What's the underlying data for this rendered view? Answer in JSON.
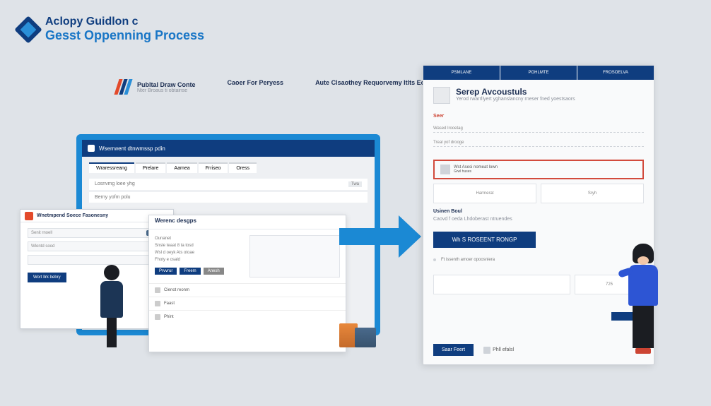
{
  "header": {
    "title1": "Aclopy Guidlon c",
    "title2": "Gesst Oppenning Process"
  },
  "brand": {
    "b1": "Publtal Draw Conte",
    "b1s": "Nter Broaus ti obtainse",
    "b2": "Caoer For Peryess",
    "b3": "Aute Clsaothey Requorvemy Itlts Eothres"
  },
  "monitor": {
    "bar": "Wserrwent dtnwmssp pdin",
    "tabs": [
      "Wraressreang",
      "Prelare",
      "Aamea",
      "Frriseo",
      "Oress"
    ],
    "row1_l": "Losnvmg loee yhg",
    "row1_r": "Twa",
    "row2_l": "Berny yofm polu"
  },
  "dialog": {
    "title": "Wnetmpend Soece Fasonesny",
    "f1": "Senit rnoell",
    "f2": "Wlontd sood",
    "btn": "UOS",
    "action": "Wort llrk bebry"
  },
  "panel": {
    "title": "Werenc desgps",
    "l1": "Ounanet",
    "l2": "Snsle teaat 8 ta tosd",
    "l3": "Wsl d oeyk Ats otoae",
    "l4": "Fhoty e osald",
    "b1": "Prvvrur",
    "b2": "Freem",
    "b3": "Anesh",
    "s1": "Cienot reonm",
    "s2": "Faast",
    "s3": "Phint"
  },
  "form": {
    "t1": "PSMLANE",
    "t2": "POHLMTE",
    "t3": "FROSOELVA",
    "title": "Serep Avcoustuls",
    "sub": "Yerod rwarrllyert yghanslancny rneser fned yoestsaors",
    "sec1": "Seer",
    "f1": "Wased lrooetag",
    "f2": "Treal yof drooge",
    "box_t": "Wst Asesi nomeat lown",
    "box_s": "Grwl huses",
    "sec2": "Usinen Boul",
    "sec2_sub": "Caovd f oeda Lhdoberast ntruendes",
    "action": "Wh S ROSEENT RONGP",
    "extra": "Ft issenth amoer   opoosniera",
    "grid1": "Harmerat",
    "grid2": "Sryh",
    "grid3": "725",
    "bot_btn": "Saar Feert",
    "bot_opt": "Phll efalsl"
  }
}
